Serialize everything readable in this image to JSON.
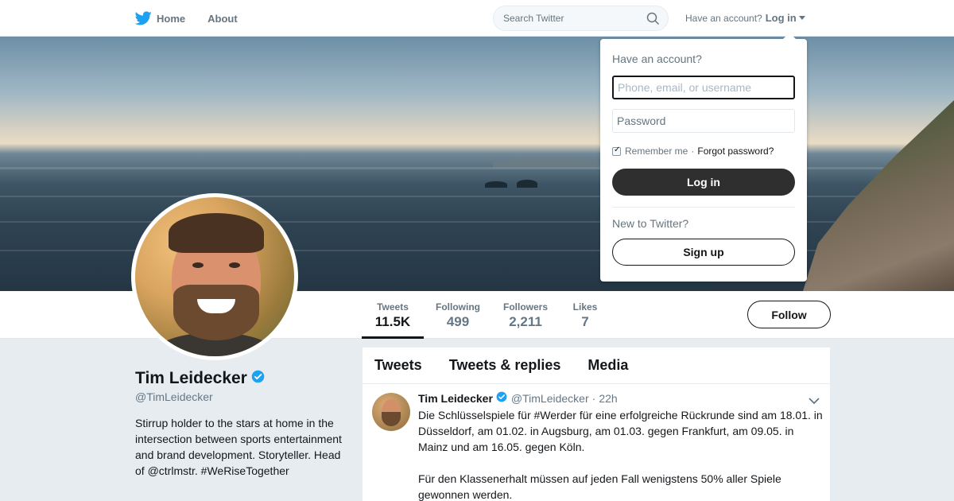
{
  "nav": {
    "home_label": "Home",
    "about_label": "About",
    "search_placeholder": "Search Twitter",
    "account_prompt": "Have an account?",
    "login_label": "Log in"
  },
  "colors": {
    "brand_blue": "#1da1f2",
    "dark_button": "#2f2f2f",
    "muted_text": "#657786",
    "background": "#e6ecf0"
  },
  "profile": {
    "name": "Tim Leidecker",
    "handle": "@TimLeidecker",
    "bio": "Stirrup holder to the stars at home in the intersection between sports entertainment and brand development. Storyteller. Head of @ctrlmstr. #WeRiseTogether",
    "verified": true
  },
  "stats": [
    {
      "label": "Tweets",
      "value": "11.5K",
      "active": true
    },
    {
      "label": "Following",
      "value": "499",
      "active": false
    },
    {
      "label": "Followers",
      "value": "2,211",
      "active": false
    },
    {
      "label": "Likes",
      "value": "7",
      "active": false
    }
  ],
  "follow_label": "Follow",
  "timeline": {
    "tabs": [
      "Tweets",
      "Tweets & replies",
      "Media"
    ],
    "tweet": {
      "name": "Tim Leidecker",
      "handle": "@TimLeidecker",
      "separator": "·",
      "time": "22h",
      "paragraphs": [
        "Die Schlüsselspiele für #Werder für eine erfolgreiche Rückrunde sind am 18.01. in Düsseldorf, am 01.02. in Augsburg, am 01.03. gegen Frankfurt, am 09.05. in Mainz und am 16.05. gegen Köln.",
        "Für den Klassenerhalt müssen auf jeden Fall wenigstens 50% aller Spiele gewonnen werden."
      ]
    }
  },
  "login_dropdown": {
    "title": "Have an account?",
    "username_placeholder": "Phone, email, or username",
    "password_placeholder": "Password",
    "remember_label": "Remember me",
    "separator": "·",
    "forgot_label": "Forgot password?",
    "login_button": "Log in",
    "new_prompt": "New to Twitter?",
    "signup_button": "Sign up",
    "remember_checked": true
  },
  "icons": {
    "brand": "twitter-bird-icon",
    "search": "search-icon",
    "verified": "verified-badge-icon",
    "caret": "caret-down-icon",
    "chevron": "chevron-down-icon"
  }
}
